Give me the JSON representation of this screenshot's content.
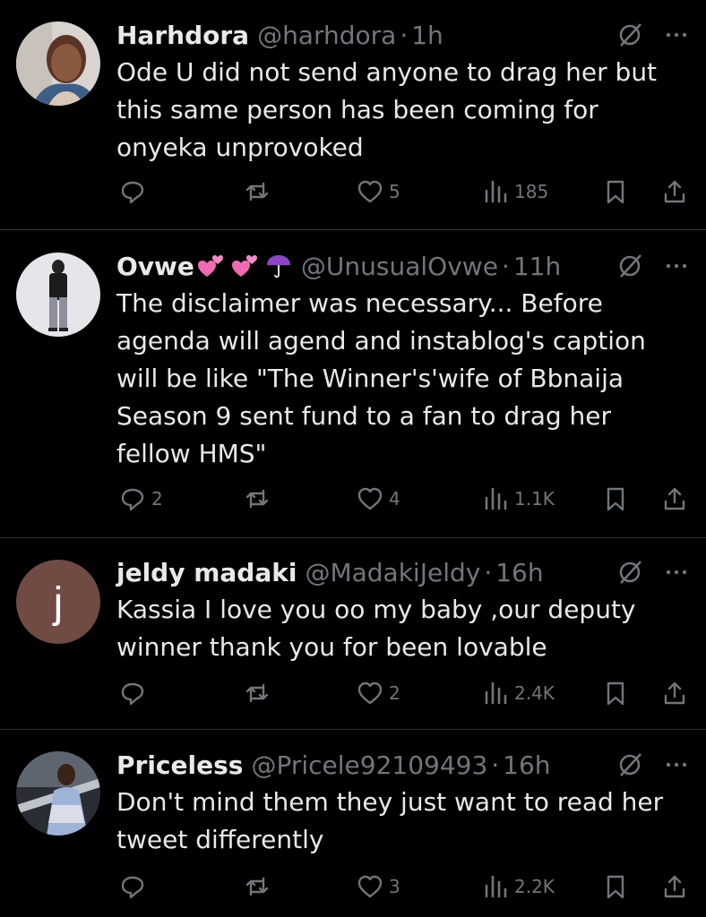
{
  "tweets": [
    {
      "name": "Harhdora",
      "handle": "@harhdora",
      "time": "1h",
      "text_lines": [
        "Ode U did not send anyone to drag her but",
        "this same person has been coming for",
        "onyeka unprovoked"
      ],
      "replies": "",
      "retweets": "",
      "likes": "5",
      "views": "185",
      "avatar": "photo"
    },
    {
      "name": "Ovwe",
      "name_emojis": [
        "pink-hearts-icon",
        "pink-hearts-icon",
        "purple-umbrella-icon"
      ],
      "handle": "@UnusualOvwe",
      "time": "11h",
      "text_lines": [
        "The disclaimer was necessary... Before",
        "agenda will agend and instablog's caption",
        "will be like \"The Winner's'wife of Bbnaija",
        "Season 9 sent fund to a fan to drag her",
        "fellow HMS\""
      ],
      "replies": "2",
      "retweets": "",
      "likes": "4",
      "views": "1.1K",
      "avatar": "photo"
    },
    {
      "name": "jeldy madaki",
      "handle": "@MadakiJeldy",
      "time": "16h",
      "text_lines": [
        "Kassia I love you oo my baby ,our deputy",
        "winner thank you for been lovable"
      ],
      "replies": "",
      "retweets": "",
      "likes": "2",
      "views": "2.4K",
      "avatar_letter": "j",
      "avatar_color": "#6f4b44"
    },
    {
      "name": "Priceless",
      "handle": "@Pricele92109493",
      "time": "16h",
      "text_lines": [
        "Don't mind them they just want to read her",
        "tweet differently"
      ],
      "replies": "",
      "retweets": "",
      "likes": "3",
      "views": "2.2K",
      "avatar": "photo"
    }
  ],
  "separator": "·",
  "colors": {
    "background": "#000000",
    "text": "#e7e9ea",
    "muted": "#71767b",
    "divider": "#2f3336"
  }
}
